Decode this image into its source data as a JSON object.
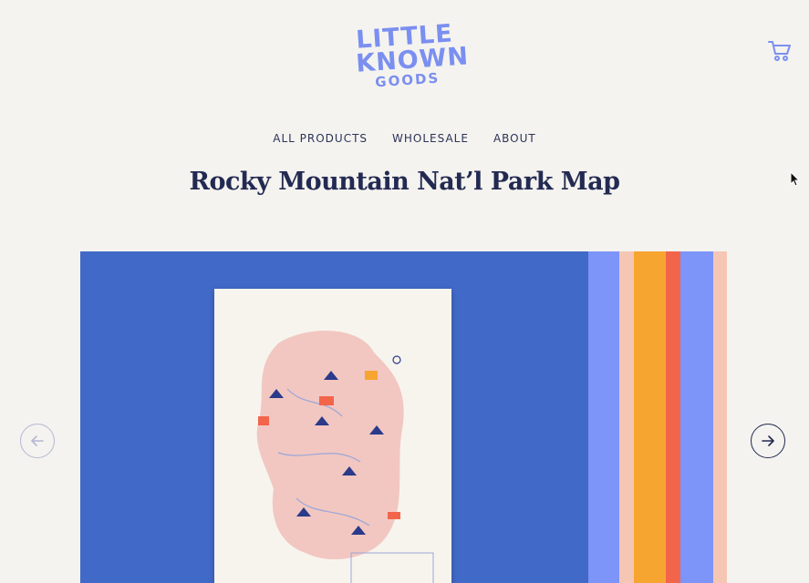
{
  "brand": {
    "line1": "LITTLE",
    "line2": "KNOWN",
    "line3": "GOODS"
  },
  "header": {
    "cart_icon": "cart-icon"
  },
  "nav": {
    "items": [
      {
        "label": "ALL PRODUCTS"
      },
      {
        "label": "WHOLESALE"
      },
      {
        "label": "ABOUT"
      }
    ]
  },
  "product": {
    "title": "Rocky Mountain Nat’l Park Map"
  },
  "gallery": {
    "prev_icon": "arrow-left-icon",
    "next_icon": "arrow-right-icon"
  },
  "colors": {
    "background": "#f4f3ef",
    "title": "#232a52",
    "logo": "#7b8ff0",
    "photo_blue": "#4169c7",
    "stripe_periwinkle": "#7d94f8",
    "stripe_peach": "#f6c6b4",
    "stripe_orange": "#f7a531",
    "stripe_red": "#f2654a",
    "map_pink": "#f2c7c1"
  }
}
